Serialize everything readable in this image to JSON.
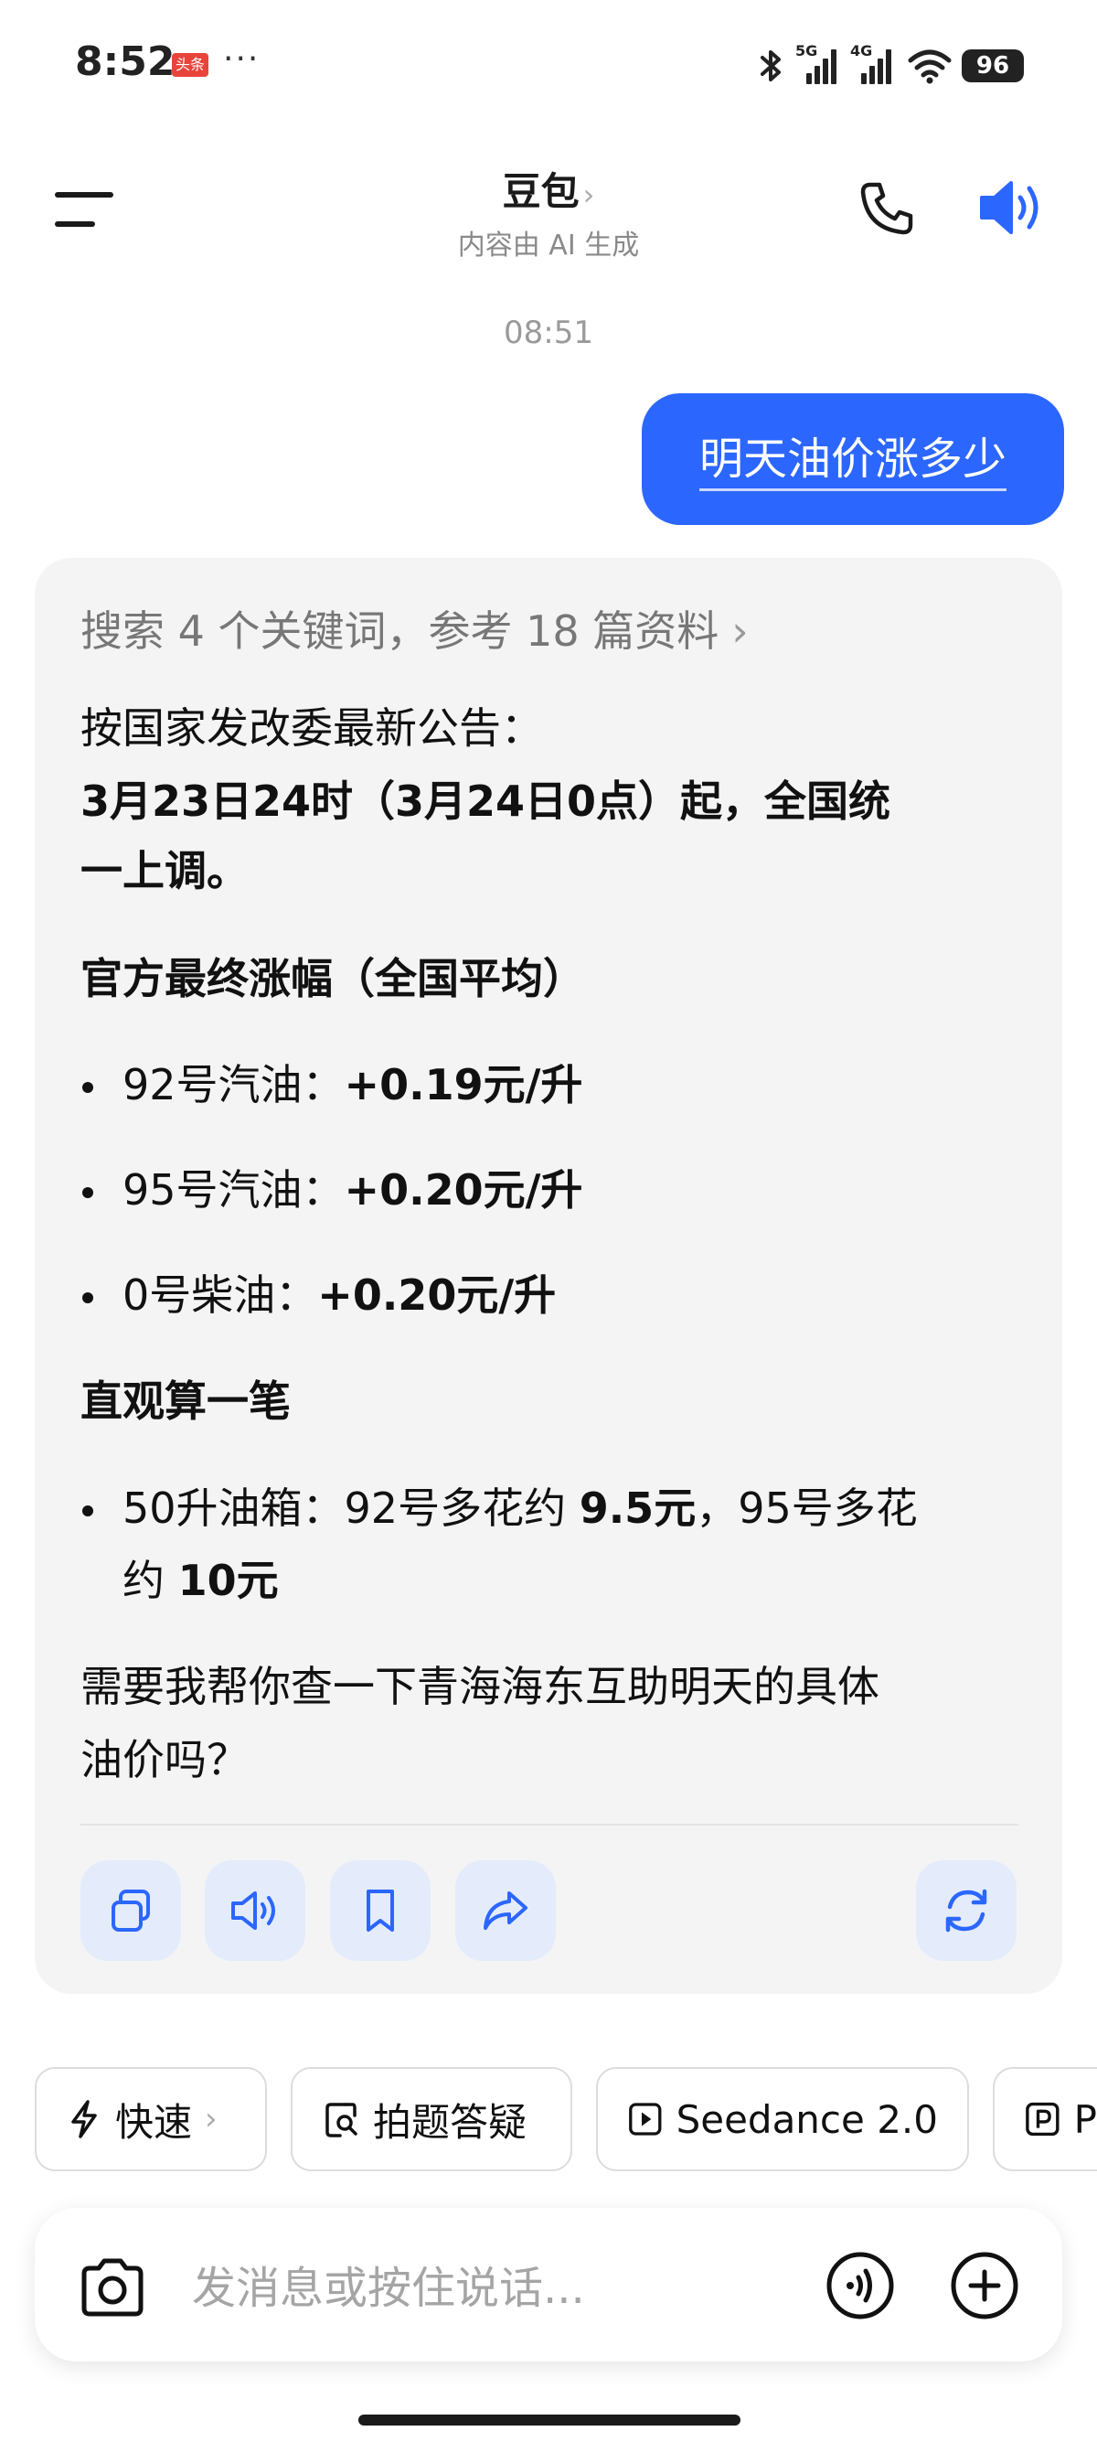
{
  "status_bar": {
    "time": "8:52",
    "badge": "头条",
    "dots": "···",
    "net1": "5G",
    "net2": "4G",
    "battery": "96"
  },
  "header": {
    "title": "豆包",
    "title_chevron": "›",
    "subtitle": "内容由 AI 生成",
    "icons": [
      "menu-icon",
      "phone-icon",
      "speaker-icon"
    ],
    "accent_color": "#2b66ff"
  },
  "chat": {
    "timestamp": "08:51",
    "user_message": "明天油价涨多少",
    "answer": {
      "search_summary": "搜索 4 个关键词，参考 18 篇资料",
      "search_chevron": "›",
      "intro": "按国家发改委最新公告：",
      "headline_line1": "3月23日24时（3月24日0点）起，全国统",
      "headline_line2": "一上调。",
      "section1_title": "官方最终涨幅（全国平均）",
      "items": [
        {
          "label": "92号汽油：",
          "value": "+0.19元/升"
        },
        {
          "label": "95号汽油：",
          "value": "+0.20元/升"
        },
        {
          "label": "0号柴油：",
          "value": "+0.20元/升"
        }
      ],
      "section2_title": "直观算一笔",
      "calc": {
        "part1": "50升油箱：92号多花约 ",
        "value1": "9.5元",
        "part2": "，95号多花",
        "part3": "约 ",
        "value2": "10元"
      },
      "followup_line1": "需要我帮你查一下青海海东互助明天的具体",
      "followup_line2": "油价吗？",
      "actions": [
        "copy-icon",
        "read-aloud-icon",
        "bookmark-icon",
        "share-icon",
        "regenerate-icon"
      ]
    }
  },
  "chips": [
    {
      "label": "快速",
      "chevron": "›",
      "icon": "lightning-icon"
    },
    {
      "label": "拍题答疑",
      "icon": "photo-search-icon"
    },
    {
      "label": "Seedance 2.0",
      "icon": "play-icon"
    },
    {
      "label": "P",
      "icon": "p-icon"
    }
  ],
  "input": {
    "placeholder": "发消息或按住说话..."
  }
}
